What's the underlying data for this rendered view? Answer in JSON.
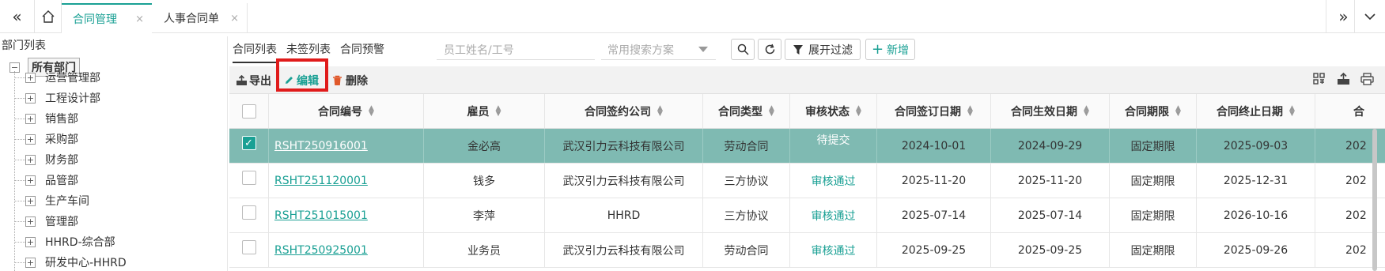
{
  "topbar": {
    "collapse_icon": "double-chevron-left-icon",
    "home_icon": "home-icon",
    "tabs": [
      {
        "label": "合同管理",
        "close": "×"
      },
      {
        "label": "人事合同单",
        "close": "×"
      }
    ],
    "expand_icon": "double-chevron-right-icon",
    "menu_icon": "chevron-down-icon"
  },
  "sidebar": {
    "title": "部门列表",
    "root": {
      "toggle": "−",
      "label": "所有部门"
    },
    "items": [
      {
        "toggle": "+",
        "label": "运营管理部"
      },
      {
        "toggle": "+",
        "label": "工程设计部"
      },
      {
        "toggle": "+",
        "label": "销售部"
      },
      {
        "toggle": "+",
        "label": "采购部"
      },
      {
        "toggle": "+",
        "label": "财务部"
      },
      {
        "toggle": "+",
        "label": "品管部"
      },
      {
        "toggle": "+",
        "label": "生产车间"
      },
      {
        "toggle": "+",
        "label": "管理部"
      },
      {
        "toggle": "+",
        "label": "HHRD-综合部"
      },
      {
        "toggle": "+",
        "label": "研发中心-HHRD"
      }
    ]
  },
  "subtabs": [
    "合同列表",
    "未签列表",
    "合同预警"
  ],
  "search": {
    "placeholder": "员工姓名/工号"
  },
  "scheme": {
    "placeholder": "常用搜索方案"
  },
  "buttons": {
    "search_icon": "search-icon",
    "refresh_icon": "refresh-icon",
    "filter_label": "展开过滤",
    "add_label": "新增"
  },
  "toolbar": {
    "export": "导出",
    "edit": "编辑",
    "delete": "删除",
    "right_icons": [
      "grid-icon",
      "export-icon",
      "print-icon"
    ]
  },
  "colors": {
    "accent": "#1aa094",
    "selected_row": "#7fbab2",
    "highlight": "#e01b1b"
  },
  "table": {
    "headers": [
      "合同编号",
      "雇员",
      "合同签约公司",
      "合同类型",
      "审核状态",
      "合同签订日期",
      "合同生效日期",
      "合同期限",
      "合同终止日期",
      "合"
    ],
    "rows": [
      {
        "checked": true,
        "cells": [
          "RSHT250916001",
          "金必高",
          "武汉引力云科技有限公司",
          "劳动合同",
          "待提交",
          "2024-10-01",
          "2024-09-29",
          "固定期限",
          "2025-09-03",
          "202"
        ]
      },
      {
        "checked": false,
        "cells": [
          "RSHT251120001",
          "钱多",
          "武汉引力云科技有限公司",
          "三方协议",
          "审核通过",
          "2025-11-20",
          "2025-11-20",
          "固定期限",
          "2025-12-31",
          "202"
        ]
      },
      {
        "checked": false,
        "cells": [
          "RSHT251015001",
          "李萍",
          "HHRD",
          "三方协议",
          "审核通过",
          "2025-07-14",
          "2025-07-14",
          "固定期限",
          "2026-10-16",
          "202"
        ]
      },
      {
        "checked": false,
        "cells": [
          "RSHT250925001",
          "业务员",
          "武汉引力云科技有限公司",
          "劳动合同",
          "审核通过",
          "2025-09-25",
          "2025-09-25",
          "固定期限",
          "2025-09-26",
          "202"
        ]
      }
    ]
  }
}
